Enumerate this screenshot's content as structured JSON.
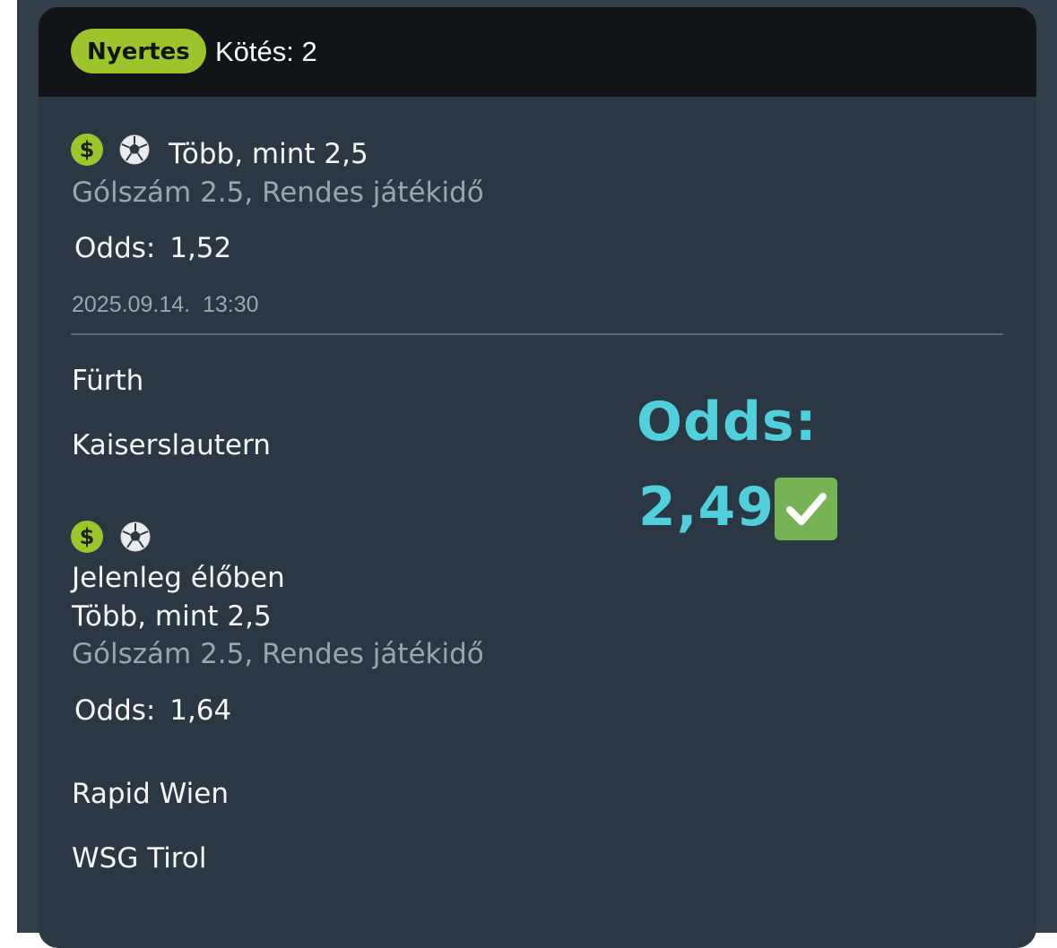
{
  "header": {
    "status_badge": "Nyertes",
    "title": "Kötés: 2"
  },
  "selection_1": {
    "pick": "Több, mint 2,5",
    "market": "Gólszám 2.5, Rendes játékidő",
    "odds_label": "Odds:",
    "odds_value": "1,52",
    "datetime": "2025.09.14.  13:30",
    "home_team": "Fürth",
    "away_team": "Kaiserslautern",
    "icons": [
      "dollar-icon",
      "soccer-ball-icon"
    ]
  },
  "selection_2": {
    "live_status": "Jelenleg élőben",
    "pick": "Több, mint 2,5",
    "market": "Gólszám 2.5, Rendes játékidő",
    "odds_label": "Odds:",
    "odds_value": "1,64",
    "home_team": "Rapid Wien",
    "away_team": "WSG Tirol",
    "icons": [
      "dollar-icon",
      "soccer-ball-icon"
    ]
  },
  "overlay": {
    "total_odds_label": "Odds:",
    "total_odds_value": "2,49",
    "icon": "check-mark-button-icon"
  },
  "colors": {
    "badge_green": "#9dc42a",
    "accent_cyan": "#4fd0dc",
    "card_bg": "#2b3843",
    "header_bg": "#111518"
  }
}
